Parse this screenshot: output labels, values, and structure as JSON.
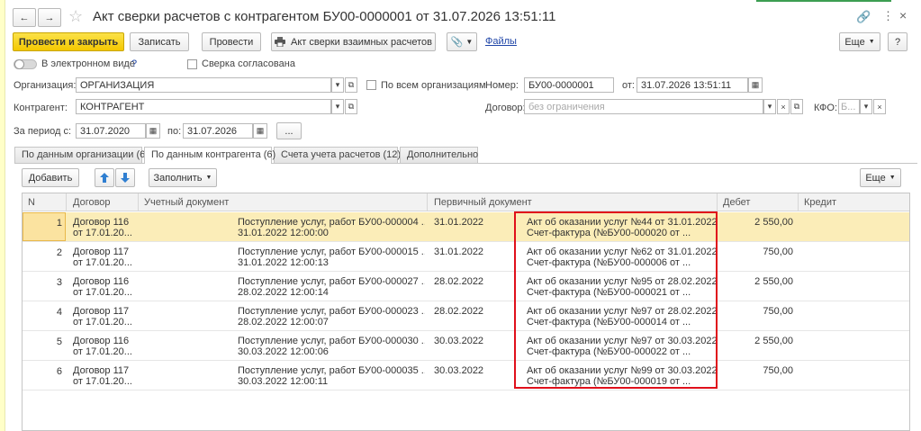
{
  "window": {
    "title": "Акт сверки расчетов с контрагентом БУ00-0000001 от 31.07.2026 13:51:11"
  },
  "toolbar": {
    "post_close": "Провести и закрыть",
    "save": "Записать",
    "post": "Провести",
    "print_act": "Акт сверки взаимных расчетов",
    "files": "Файлы",
    "more": "Еще",
    "help": "?"
  },
  "options": {
    "electronic": "В электронном виде",
    "electronic_help": "?",
    "agreed": "Сверка согласована"
  },
  "form": {
    "org_label": "Организация:",
    "org_value": "ОРГАНИЗАЦИЯ",
    "all_orgs": "По всем организациям",
    "number_label": "Номер:",
    "number_value": "БУ00-0000001",
    "date_label": "от:",
    "date_value": "31.07.2026 13:51:11",
    "counterparty_label": "Контрагент:",
    "counterparty_value": "КОНТРАГЕНТ",
    "contract_label": "Договор:",
    "contract_placeholder": "без ограничения",
    "kfo_label": "КФО:",
    "kfo_value": "Б...",
    "period_label": "За период с:",
    "period_from": "31.07.2020",
    "period_to_label": "по:",
    "period_to": "31.07.2026",
    "period_more": "..."
  },
  "tabs": [
    {
      "label": "По данным организации (6)"
    },
    {
      "label": "По данным контрагента (6)"
    },
    {
      "label": "Счета учета расчетов (12)"
    },
    {
      "label": "Дополнительно"
    }
  ],
  "table_toolbar": {
    "add": "Добавить",
    "fill": "Заполнить",
    "more": "Еще"
  },
  "table": {
    "columns": [
      "N",
      "Договор",
      "Учетный документ",
      "Первичный документ",
      "Дебет",
      "Кредит"
    ],
    "rows": [
      {
        "n": "1",
        "contract1": "Договор 116",
        "contract2": "от 17.01.20...",
        "doc1": "Поступление услуг, работ БУ00-000004 ...",
        "doc2": "31.01.2022 12:00:00",
        "date": "31.01.2022",
        "prim1": "Акт об оказании услуг №44 от 31.01.2022",
        "prim2": "Счет-фактура (№БУ00-000020 от ...",
        "debit": "2 550,00",
        "credit": ""
      },
      {
        "n": "2",
        "contract1": "Договор 117",
        "contract2": "от 17.01.20...",
        "doc1": "Поступление услуг, работ БУ00-000015 ...",
        "doc2": "31.01.2022 12:00:13",
        "date": "31.01.2022",
        "prim1": "Акт об оказании услуг №62 от 31.01.2022",
        "prim2": "Счет-фактура (№БУ00-000006 от ...",
        "debit": "750,00",
        "credit": ""
      },
      {
        "n": "3",
        "contract1": "Договор 116",
        "contract2": "от 17.01.20...",
        "doc1": "Поступление услуг, работ БУ00-000027 ...",
        "doc2": "28.02.2022 12:00:14",
        "date": "28.02.2022",
        "prim1": "Акт об оказании услуг №95 от 28.02.2022",
        "prim2": "Счет-фактура (№БУ00-000021 от ...",
        "debit": "2 550,00",
        "credit": ""
      },
      {
        "n": "4",
        "contract1": "Договор 117",
        "contract2": "от 17.01.20...",
        "doc1": "Поступление услуг, работ БУ00-000023 ...",
        "doc2": "28.02.2022 12:00:07",
        "date": "28.02.2022",
        "prim1": "Акт об оказании услуг №97 от 28.02.2022",
        "prim2": "Счет-фактура (№БУ00-000014 от ...",
        "debit": "750,00",
        "credit": ""
      },
      {
        "n": "5",
        "contract1": "Договор 116",
        "contract2": "от 17.01.20...",
        "doc1": "Поступление услуг, работ БУ00-000030 ...",
        "doc2": "30.03.2022 12:00:06",
        "date": "30.03.2022",
        "prim1": "Акт об оказании услуг №97 от 30.03.2022",
        "prim2": "Счет-фактура (№БУ00-000022 от ...",
        "debit": "2 550,00",
        "credit": ""
      },
      {
        "n": "6",
        "contract1": "Договор 117",
        "contract2": "от 17.01.20...",
        "doc1": "Поступление услуг, работ БУ00-000035 ...",
        "doc2": "30.03.2022 12:00:11",
        "date": "30.03.2022",
        "prim1": "Акт об оказании услуг №99 от 30.03.2022",
        "prim2": "Счет-фактура (№БУ00-000019 от ...",
        "debit": "750,00",
        "credit": ""
      }
    ]
  },
  "icons": {
    "back": "arrow-left-icon",
    "forward": "arrow-right-icon",
    "favorite": "star-icon",
    "link": "link-icon",
    "menu": "vertical-dots-icon",
    "close": "close-icon",
    "printer": "printer-icon",
    "attach": "paperclip-icon",
    "calendar": "calendar-icon",
    "up": "arrow-up-icon",
    "down": "arrow-down-icon"
  },
  "colors": {
    "accent_yellow": "#f4c800",
    "selected_row": "#fbedb8",
    "highlight_box": "#e0101b",
    "link": "#2046a8",
    "arrow_blue": "#2f7fd1"
  }
}
